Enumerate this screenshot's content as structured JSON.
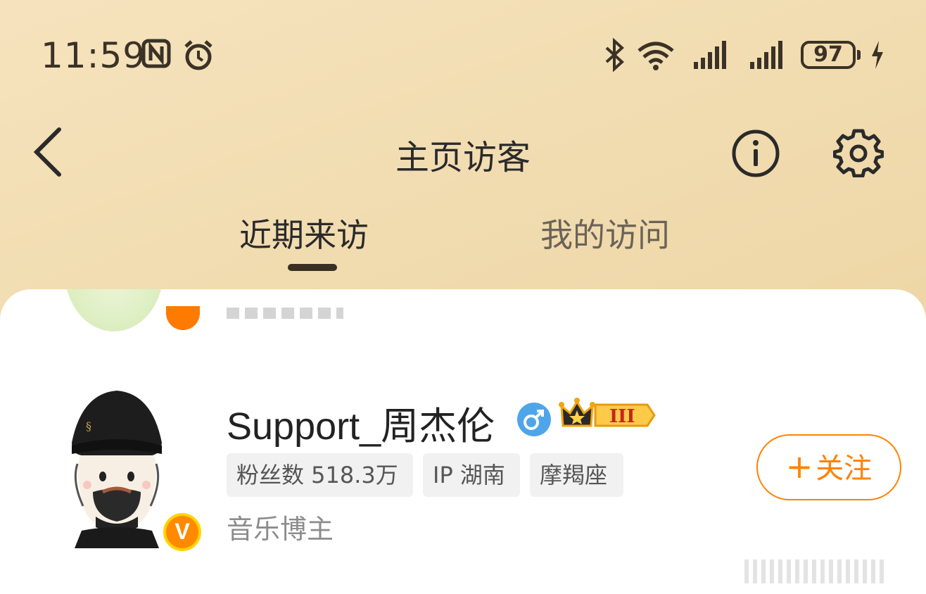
{
  "status_bar": {
    "time": "11:59",
    "battery": "97",
    "icons": [
      "nfc-icon",
      "alarm-icon",
      "bluetooth-icon",
      "wifi-icon",
      "signal-icon",
      "signal-icon",
      "charging-icon"
    ]
  },
  "header": {
    "title": "主页访客",
    "back_icon": "chevron-left-icon",
    "info_icon": "info-icon",
    "settings_icon": "gear-icon"
  },
  "tabs": [
    {
      "label": "近期来访",
      "active": true
    },
    {
      "label": "我的访问",
      "active": false
    }
  ],
  "visitor": {
    "username": "Support_周杰伦",
    "gender_icon": "male-icon",
    "vip_level": "III",
    "verified_badge": "V",
    "chips": {
      "fans": "粉丝数 518.3万",
      "ip": "IP 湖南",
      "zodiac": "摩羯座"
    },
    "category": "音乐博主",
    "follow_label": "关注",
    "follow_plus": "+"
  },
  "colors": {
    "accent": "#ff8200",
    "background": "#f1dcb0"
  }
}
